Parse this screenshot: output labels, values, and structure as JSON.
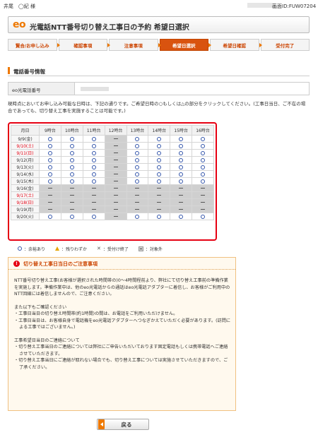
{
  "header": {
    "user": "井尾　◯紀 様",
    "screen_id": "画面ID:FUW07204"
  },
  "title": {
    "logo": "eo",
    "text": "光電話NTT番号切り替え工事日の予約 希望日選択"
  },
  "steps": [
    {
      "label": "賢合/お申し込み",
      "active": false
    },
    {
      "label": "確認事項",
      "active": false
    },
    {
      "label": "注意事項",
      "active": false
    },
    {
      "label": "希望日選択",
      "active": true
    },
    {
      "label": "希望日確認",
      "active": false
    },
    {
      "label": "受付完了",
      "active": false
    }
  ],
  "section_title": "電話番号情報",
  "phone_label": "eo光電話番号",
  "notice": "現時点においてお申し込み可能な日時は、下記の通りです。ご希望日時の○もしくは△の部分をクリックしてください。(工事日当日、ご不在の場合であっても、切り替え工事を実施することは可能です。)",
  "calendar": {
    "headers": [
      "月日",
      "9時台",
      "10時台",
      "11時台",
      "12時台",
      "13時台",
      "14時台",
      "15時台",
      "16時台"
    ],
    "rows": [
      {
        "date": "9/9(金)",
        "red": false,
        "slots": [
          "o",
          "o",
          "o",
          "-",
          "o",
          "o",
          "o",
          "o"
        ]
      },
      {
        "date": "9/10(土)",
        "red": true,
        "slots": [
          "o",
          "o",
          "o",
          "-",
          "o",
          "o",
          "o",
          "o"
        ]
      },
      {
        "date": "9/11(日)",
        "red": true,
        "slots": [
          "o",
          "o",
          "o",
          "-",
          "o",
          "o",
          "o",
          "o"
        ]
      },
      {
        "date": "9/12(月)",
        "red": false,
        "slots": [
          "o",
          "o",
          "o",
          "-",
          "o",
          "o",
          "o",
          "o"
        ]
      },
      {
        "date": "9/13(火)",
        "red": false,
        "slots": [
          "o",
          "o",
          "o",
          "-",
          "o",
          "o",
          "o",
          "o"
        ]
      },
      {
        "date": "9/14(水)",
        "red": false,
        "slots": [
          "o",
          "o",
          "o",
          "-",
          "o",
          "o",
          "o",
          "o"
        ]
      },
      {
        "date": "9/15(木)",
        "red": false,
        "slots": [
          "o",
          "o",
          "o",
          "-",
          "o",
          "o",
          "o",
          "o"
        ]
      },
      {
        "date": "9/16(金)",
        "red": false,
        "slots": [
          "-",
          "-",
          "-",
          "-",
          "-",
          "-",
          "-",
          "-"
        ]
      },
      {
        "date": "9/17(土)",
        "red": true,
        "slots": [
          "-",
          "-",
          "-",
          "-",
          "-",
          "-",
          "-",
          "-"
        ]
      },
      {
        "date": "9/18(日)",
        "red": true,
        "slots": [
          "-",
          "-",
          "-",
          "-",
          "-",
          "-",
          "-",
          "-"
        ]
      },
      {
        "date": "9/19(月)",
        "red": false,
        "slots": [
          "-",
          "-",
          "-",
          "-",
          "-",
          "-",
          "-",
          "-"
        ]
      },
      {
        "date": "9/20(火)",
        "red": false,
        "slots": [
          "o",
          "o",
          "o",
          "-",
          "o",
          "o",
          "o",
          "o"
        ]
      }
    ]
  },
  "legend": {
    "available": "：余裕あり",
    "few": "：残りわずか",
    "closed": "：受付け終了",
    "na": "：対象外"
  },
  "caution": {
    "title": "切り替え工事日当日のご注意事項",
    "p1": "NTT番号切り替え工事(お客様が選択された時間帯の)0～4時間程前より、弊社にて切り替え工事前の準備作業を実施します。準備作業中は、他のeo光電話からの通話はeo光電話アダプターに着信し、お客様がご利用中のNTT回線には着信しませんので、ご注意ください。",
    "p2_title": "また以下もご確認ください",
    "p2_item1": "・工事日当日の切り替え時間帯(約1時間)の間は、お電話をご利用いただけません。",
    "p2_item2": "・工事日当日は、お客様自身で電話機をeo光電話アダプターへつなぎかえていただく必要があります。(訪問による工事ではございません。)",
    "p3_title": "工事希望日当日のご連絡について",
    "p3_item1": "・切り替え工事当日のご連絡については弊社にご申告いただいております固定電話もしくは携帯電話へご連絡させていただきます。",
    "p3_item2": "・切り替え工事当日にご連絡が取れない場合でも、切り替え工事については実施させていただきますので、ご了承ください。"
  },
  "back_button": "戻る"
}
